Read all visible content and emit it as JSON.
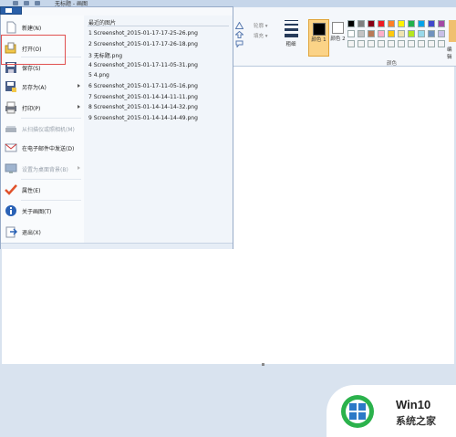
{
  "window": {
    "title": "无标题 - 画图"
  },
  "ribbon": {
    "outline_label": "轮廓 ▾",
    "fill_label": "填充 ▾",
    "size_label": "粗细",
    "color1_label": "颜色 1",
    "color2_label": "颜色 2",
    "colors_group_label": "颜色",
    "edit_colors_label": "编辑",
    "palette_row1": [
      "#000000",
      "#7f7f7f",
      "#880015",
      "#ed1c24",
      "#ff7f27",
      "#fff200",
      "#22b14c",
      "#00a2e8",
      "#3f48cc",
      "#a349a4"
    ],
    "palette_row2": [
      "#ffffff",
      "#c3c3c3",
      "#b97a57",
      "#ffaec9",
      "#ffc90e",
      "#efe4b0",
      "#b5e61d",
      "#99d9ea",
      "#7092be",
      "#c8bfe7"
    ]
  },
  "app_menu": {
    "items": [
      {
        "label": "新建(N)",
        "icon": "new-file-icon",
        "submenu": false,
        "disabled": false
      },
      {
        "label": "打开(O)",
        "icon": "open-folder-icon",
        "submenu": false,
        "disabled": false
      },
      {
        "label": "保存(S)",
        "icon": "save-icon",
        "submenu": false,
        "disabled": false
      },
      {
        "label": "另存为(A)",
        "icon": "save-as-icon",
        "submenu": true,
        "disabled": false
      },
      {
        "label": "打印(P)",
        "icon": "print-icon",
        "submenu": true,
        "disabled": false
      },
      {
        "label": "从扫描仪或照相机(M)",
        "icon": "scanner-icon",
        "submenu": false,
        "disabled": true
      },
      {
        "label": "在电子邮件中发送(D)",
        "icon": "email-icon",
        "submenu": false,
        "disabled": false
      },
      {
        "label": "设置为桌面背景(B)",
        "icon": "desktop-background-icon",
        "submenu": true,
        "disabled": true
      },
      {
        "label": "属性(E)",
        "icon": "properties-check-icon",
        "submenu": false,
        "disabled": false
      },
      {
        "label": "关于画图(T)",
        "icon": "about-info-icon",
        "submenu": false,
        "disabled": false
      },
      {
        "label": "退出(X)",
        "icon": "exit-icon",
        "submenu": false,
        "disabled": false
      }
    ],
    "recent_title": "最近的图片",
    "recent": [
      "1 Screenshot_2015-01-17-17-25-26.png",
      "2 Screenshot_2015-01-17-17-26-18.png",
      "3 无标题.png",
      "4 Screenshot_2015-01-17-11-05-31.png",
      "5 4.png",
      "6 Screenshot_2015-01-17-11-05-16.png",
      "7 Screenshot_2015-01-14-14-11-11.png",
      "8 Screenshot_2015-01-14-14-14-32.png",
      "9 Screenshot_2015-01-14-14-14-49.png"
    ]
  },
  "watermark": {
    "brand": "Win10",
    "site": "系统之家"
  }
}
